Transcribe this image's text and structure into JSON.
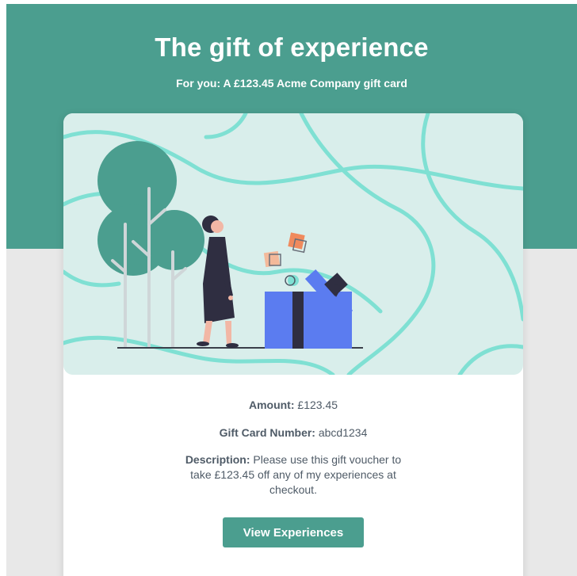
{
  "header": {
    "title": "The gift of experience",
    "subtitle": "For you: A £123.45 Acme Company gift card"
  },
  "details": {
    "amount_label": "Amount:",
    "amount_value": "£123.45",
    "number_label": "Gift Card Number:",
    "number_value": "abcd1234",
    "description_label": "Description:",
    "description_value": "Please use this gift voucher to take £123.45 off any of my experiences at checkout."
  },
  "cta": {
    "label": "View Experiences"
  },
  "colors": {
    "brand": "#4b9e8f",
    "illustration_bg": "#d9eeeb",
    "wave": "#7fe0d3",
    "gift_blue": "#5b7cf0",
    "text": "#4f5b67"
  },
  "icons": [
    "gift-illustration"
  ]
}
